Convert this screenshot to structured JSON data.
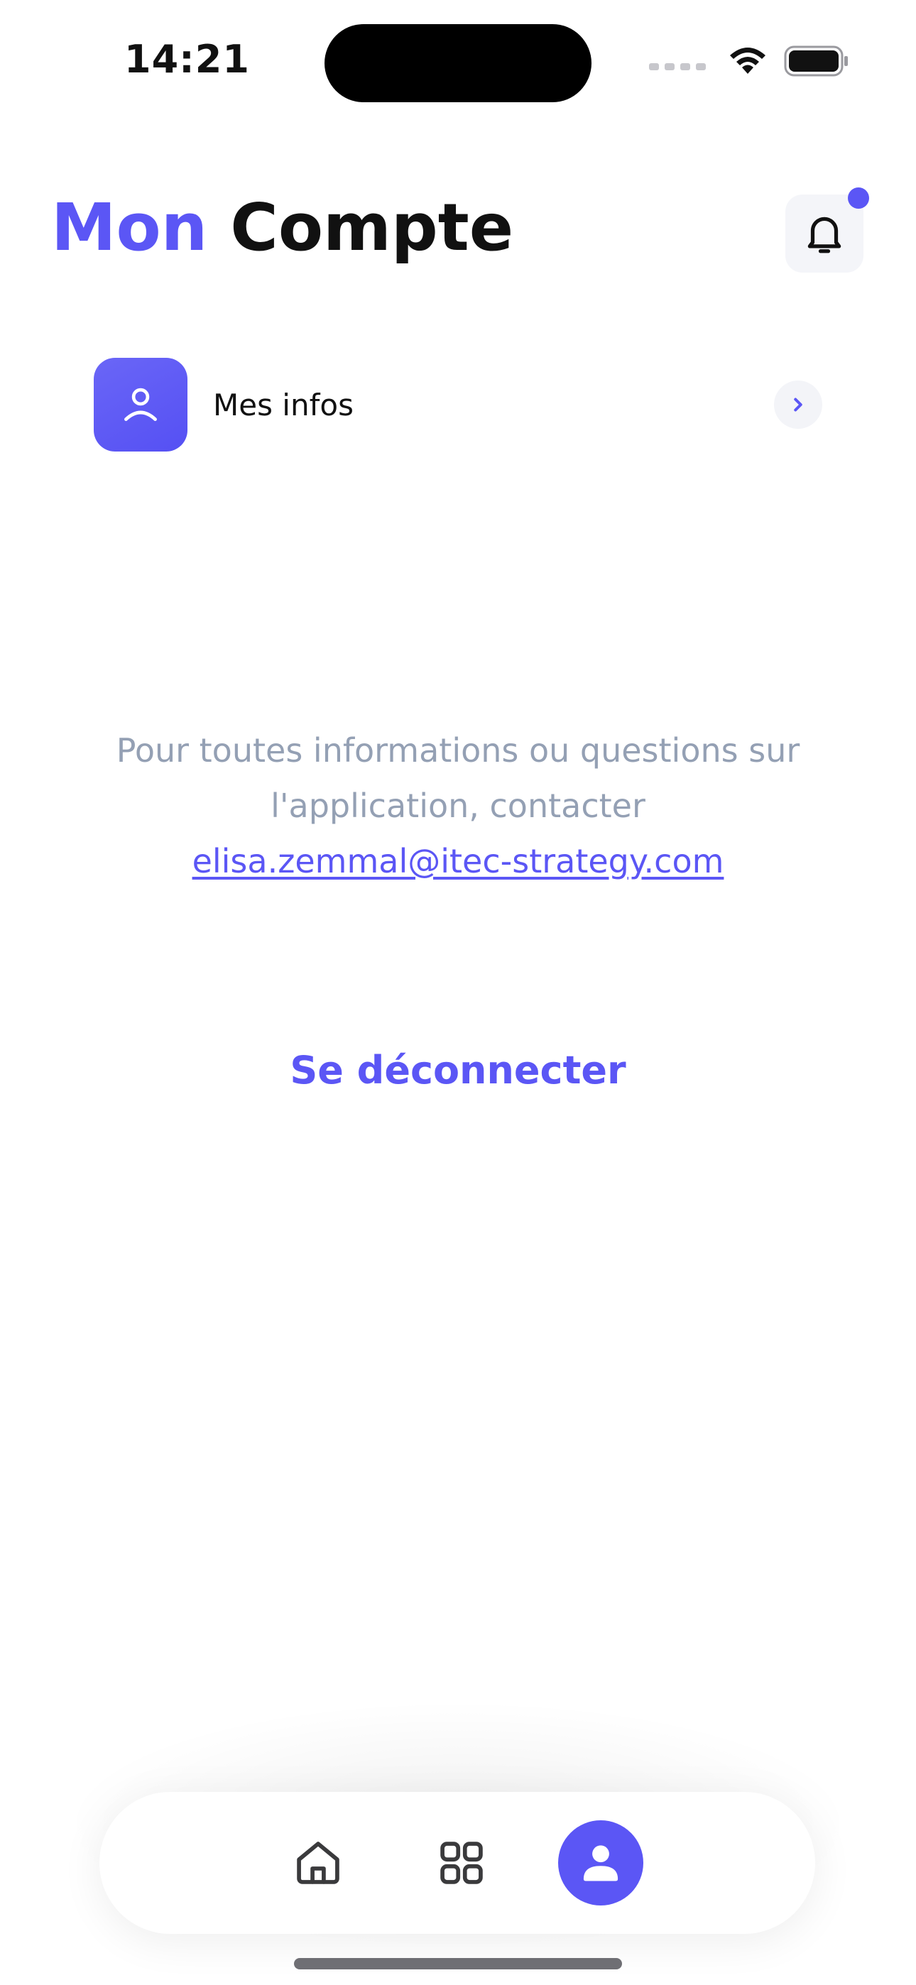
{
  "status_bar": {
    "time": "14:21"
  },
  "header": {
    "title_accent": "Mon",
    "title_main": "Compte",
    "accent_color": "#5b56f5",
    "notification_icon": "bell-icon"
  },
  "menu": {
    "items": [
      {
        "label": "Mes infos",
        "icon": "user-icon"
      }
    ]
  },
  "contact": {
    "line1": "Pour toutes informations ou  questions sur",
    "line2": "l'application, contacter",
    "email": "elisa.zemmal@itec-strategy.com"
  },
  "logout": {
    "label": "Se déconnecter"
  },
  "tabbar": {
    "tabs": [
      {
        "icon": "home-icon",
        "active": false
      },
      {
        "icon": "grid-icon",
        "active": false
      },
      {
        "icon": "person-icon",
        "active": true
      }
    ]
  }
}
